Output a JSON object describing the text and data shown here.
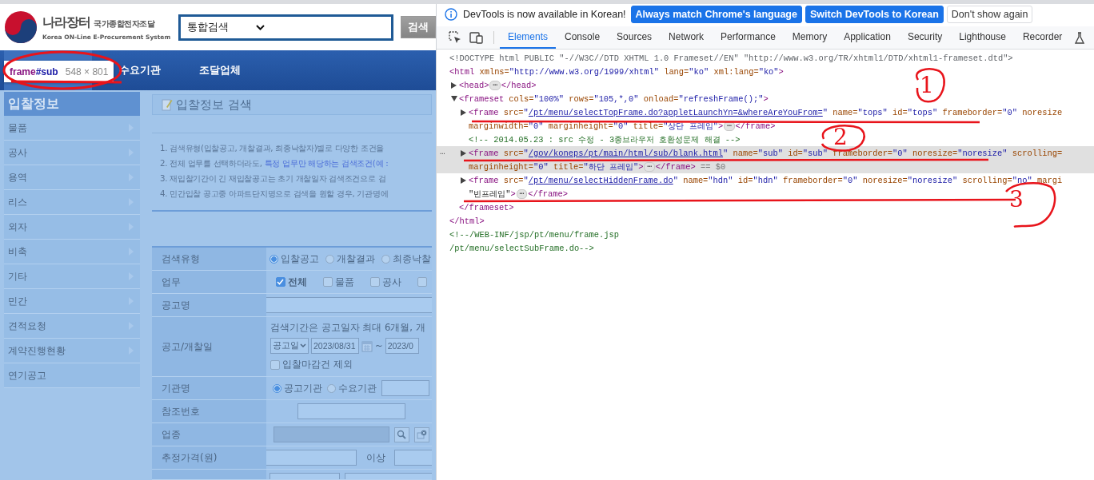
{
  "page": {
    "logo": {
      "title": "나라장터",
      "subtitle": "국가종합전자조달",
      "english": "Korea ON-Line E-Procurement System"
    },
    "search": {
      "scope": "통합검색",
      "button": "검색"
    },
    "nav": [
      {
        "selected": true
      },
      {
        "label": "수요기관",
        "selected": false
      },
      {
        "label": "조달업체",
        "selected": false
      }
    ],
    "frame_tooltip": {
      "tag": "frame",
      "id": "#sub",
      "size": "548 × 801"
    },
    "sidebar": {
      "title": "입찰정보",
      "items": [
        {
          "label": "물품",
          "expandable": true
        },
        {
          "label": "공사",
          "expandable": true
        },
        {
          "label": "용역",
          "expandable": true
        },
        {
          "label": "리스",
          "expandable": true
        },
        {
          "label": "외자",
          "expandable": true
        },
        {
          "label": "비축",
          "expandable": true
        },
        {
          "label": "기타",
          "expandable": true
        },
        {
          "label": "민간",
          "expandable": true
        },
        {
          "label": "견적요청",
          "expandable": true
        },
        {
          "label": "계약진행현황",
          "expandable": true
        },
        {
          "label": "연기공고",
          "expandable": false
        }
      ]
    },
    "panel_title": "입찰정보 검색",
    "notes": [
      {
        "text": "1. 검색유형(입찰공고, 개찰결과, 최종낙찰자)별로 다양한 조건을"
      },
      {
        "text": "2. 전체 업무를 선택하더라도, ",
        "highlight": "특정 업무만 해당하는 검색조건(예 :"
      },
      {
        "text": "3. 재입찰기간이 긴 재입찰공고는 초기 개찰일자 검색조건으로 검"
      },
      {
        "text": "4. 민간입찰 공고중 아파트단지명으로 검색을 원할 경우, 기관명에"
      }
    ],
    "form": [
      {
        "label": "검색유형",
        "kind": "radio",
        "options": [
          {
            "label": "입찰공고",
            "selected": true
          },
          {
            "label": "개찰결과",
            "selected": false
          },
          {
            "label": "최종낙찰",
            "selected": false
          }
        ]
      },
      {
        "label": "업무",
        "kind": "checks",
        "options": [
          {
            "label": "전체",
            "checked": true
          },
          {
            "label": "물품",
            "checked": false
          },
          {
            "label": "공사",
            "checked": false
          },
          {
            "checked": false
          }
        ]
      },
      {
        "label": "공고명",
        "kind": "input"
      },
      {
        "label": "공고/개찰일",
        "kind": "date",
        "note": "검색기간은 공고일자 최대 6개월, 개",
        "date_type": "공고일",
        "from": "2023/08/31",
        "separator": "~",
        "to": "2023/0",
        "exclude": {
          "label": "입찰마감건 제외",
          "checked": false
        }
      },
      {
        "label": "기관명",
        "kind": "agency",
        "options": [
          {
            "label": "공고기관",
            "selected": true
          },
          {
            "label": "수요기관",
            "selected": false
          }
        ]
      },
      {
        "label": "참조번호",
        "kind": "input"
      },
      {
        "label": "업종",
        "kind": "industry",
        "disabled": true
      },
      {
        "label": "추정가격(원)",
        "kind": "range",
        "unit": "이상"
      },
      {
        "kind": "partial"
      }
    ]
  },
  "devtools": {
    "infobar": {
      "message": "DevTools is now available in Korean!",
      "buttons": [
        {
          "label": "Always match Chrome's language",
          "kind": "primary"
        },
        {
          "label": "Switch DevTools to Korean",
          "kind": "primary"
        },
        {
          "label": "Don't show again",
          "kind": "plain"
        }
      ]
    },
    "tabs": [
      {
        "label": "Elements",
        "selected": true
      },
      {
        "label": "Console",
        "selected": false
      },
      {
        "label": "Sources",
        "selected": false
      },
      {
        "label": "Network",
        "selected": false
      },
      {
        "label": "Performance",
        "selected": false
      },
      {
        "label": "Memory",
        "selected": false
      },
      {
        "label": "Application",
        "selected": false
      },
      {
        "label": "Security",
        "selected": false
      },
      {
        "label": "Lighthouse",
        "selected": false
      },
      {
        "label": "Recorder",
        "selected": false
      }
    ],
    "dom": [
      {
        "selected": false,
        "lines": [
          [
            {
              "kind": "doctype",
              "text": "<!DOCTYPE html PUBLIC \"-//W3C//DTD XHTML 1.0 Frameset//EN\" \"http://www.w3.org/TR/xhtml1/DTD/xhtml1-frameset.dtd\">"
            }
          ]
        ]
      },
      {
        "selected": false,
        "lines": [
          [
            {
              "kind": "tag",
              "text": "<html"
            },
            {
              "kind": "attr",
              "text": " xmlns="
            },
            {
              "kind": "value",
              "text": "\"http://www.w3.org/1999/xhtml\""
            },
            {
              "kind": "attr",
              "text": " lang="
            },
            {
              "kind": "value",
              "text": "\"ko\""
            },
            {
              "kind": "attr",
              "text": " xml:lang="
            },
            {
              "kind": "value",
              "text": "\"ko\""
            },
            {
              "kind": "tag",
              "text": ">"
            }
          ]
        ],
        "close": [
          {
            "kind": "tag",
            "text": "</html>"
          }
        ],
        "children": [
          {
            "selected": false,
            "expanded": false,
            "lines": [
              [
                {
                  "kind": "tag",
                  "text": "<head>"
                },
                {
                  "kind": "badge",
                  "text": "⋯"
                },
                {
                  "kind": "tag",
                  "text": "</head>"
                }
              ]
            ]
          },
          {
            "selected": false,
            "expanded": true,
            "lines": [
              [
                {
                  "kind": "tag",
                  "text": "<frameset"
                },
                {
                  "kind": "attr",
                  "text": " cols="
                },
                {
                  "kind": "value",
                  "text": "\"100%\""
                },
                {
                  "kind": "attr",
                  "text": " rows="
                },
                {
                  "kind": "value",
                  "text": "\"105,*,0\""
                },
                {
                  "kind": "attr",
                  "text": " onload="
                },
                {
                  "kind": "value",
                  "text": "\"refreshFrame();\""
                },
                {
                  "kind": "tag",
                  "text": ">"
                }
              ]
            ],
            "close": [
              {
                "kind": "tag",
                "text": "</frameset>"
              }
            ],
            "children": [
              {
                "selected": false,
                "expanded": false,
                "lines": [
                  [
                    {
                      "kind": "tag",
                      "text": "<frame"
                    },
                    {
                      "kind": "attr",
                      "text": " src="
                    },
                    {
                      "kind": "value",
                      "text": "\""
                    },
                    {
                      "kind": "link",
                      "text": "/pt/menu/selectTopFrame.do?appletLaunchYn=&whereAreYouFrom="
                    },
                    {
                      "kind": "value",
                      "text": "\""
                    },
                    {
                      "kind": "attr",
                      "text": " name="
                    },
                    {
                      "kind": "value",
                      "text": "\"tops\""
                    },
                    {
                      "kind": "attr",
                      "text": " id="
                    },
                    {
                      "kind": "value",
                      "text": "\"tops\""
                    },
                    {
                      "kind": "attr",
                      "text": " frameborder="
                    },
                    {
                      "kind": "value",
                      "text": "\"0\""
                    },
                    {
                      "kind": "attr",
                      "text": " noresize"
                    }
                  ],
                  [
                    {
                      "kind": "attr",
                      "text": "marginwidth="
                    },
                    {
                      "kind": "value",
                      "text": "\"0\""
                    },
                    {
                      "kind": "attr",
                      "text": " marginheight="
                    },
                    {
                      "kind": "value",
                      "text": "\"0\""
                    },
                    {
                      "kind": "attr",
                      "text": " title="
                    },
                    {
                      "kind": "value",
                      "text": "\"상단 프레임\""
                    },
                    {
                      "kind": "tag",
                      "text": ">"
                    },
                    {
                      "kind": "badge",
                      "text": "⋯"
                    },
                    {
                      "kind": "tag",
                      "text": "</frame>"
                    }
                  ]
                ]
              },
              {
                "selected": false,
                "lines": [
                  [
                    {
                      "kind": "comment",
                      "text": "<!-- 2014.05.23 : src 수정 - 3종브라우저 호환성문제 해결 -->"
                    }
                  ]
                ]
              },
              {
                "selected": true,
                "gutter": "…",
                "expanded": false,
                "lines": [
                  [
                    {
                      "kind": "tag",
                      "text": "<frame"
                    },
                    {
                      "kind": "attr",
                      "text": " src="
                    },
                    {
                      "kind": "value",
                      "text": "\""
                    },
                    {
                      "kind": "link",
                      "text": "/gov/koneps/pt/main/html/sub/blank.html"
                    },
                    {
                      "kind": "value",
                      "text": "\""
                    },
                    {
                      "kind": "attr",
                      "text": " name="
                    },
                    {
                      "kind": "value",
                      "text": "\"sub\""
                    },
                    {
                      "kind": "attr",
                      "text": " id="
                    },
                    {
                      "kind": "value",
                      "text": "\"sub\""
                    },
                    {
                      "kind": "attr",
                      "text": " frameborder="
                    },
                    {
                      "kind": "value",
                      "text": "\"0\""
                    },
                    {
                      "kind": "attr",
                      "text": " noresize="
                    },
                    {
                      "kind": "value",
                      "text": "\"noresize\""
                    },
                    {
                      "kind": "attr",
                      "text": " scrolling="
                    }
                  ],
                  [
                    {
                      "kind": "attr",
                      "text": "marginheight="
                    },
                    {
                      "kind": "value",
                      "text": "\"0\""
                    },
                    {
                      "kind": "attr",
                      "text": " title="
                    },
                    {
                      "kind": "value",
                      "text": "\"하단 프레임\""
                    },
                    {
                      "kind": "tag",
                      "text": ">"
                    },
                    {
                      "kind": "badge",
                      "text": "⋯"
                    },
                    {
                      "kind": "tag",
                      "text": "</frame>"
                    },
                    {
                      "kind": "dollar",
                      "text": " == $0"
                    }
                  ]
                ]
              },
              {
                "selected": false,
                "expanded": false,
                "lines": [
                  [
                    {
                      "kind": "tag",
                      "text": "<frame"
                    },
                    {
                      "kind": "attr",
                      "text": " src="
                    },
                    {
                      "kind": "value",
                      "text": "\""
                    },
                    {
                      "kind": "link",
                      "text": "/pt/menu/selectHiddenFrame.do"
                    },
                    {
                      "kind": "value",
                      "text": "\""
                    },
                    {
                      "kind": "attr",
                      "text": " name="
                    },
                    {
                      "kind": "value",
                      "text": "\"hdn\""
                    },
                    {
                      "kind": "attr",
                      "text": " id="
                    },
                    {
                      "kind": "value",
                      "text": "\"hdn\""
                    },
                    {
                      "kind": "attr",
                      "text": " frameborder="
                    },
                    {
                      "kind": "value",
                      "text": "\"0\""
                    },
                    {
                      "kind": "attr",
                      "text": " noresize="
                    },
                    {
                      "kind": "value",
                      "text": "\"noresize\""
                    },
                    {
                      "kind": "attr",
                      "text": " scrolling="
                    },
                    {
                      "kind": "value",
                      "text": "\"no\""
                    },
                    {
                      "kind": "attr",
                      "text": " margi"
                    }
                  ],
                  [
                    {
                      "kind": "text",
                      "text": "\"빈프레임\""
                    },
                    {
                      "kind": "tag",
                      "text": ">"
                    },
                    {
                      "kind": "badge",
                      "text": "⋯"
                    },
                    {
                      "kind": "tag",
                      "text": "</frame>"
                    }
                  ]
                ]
              }
            ]
          }
        ]
      },
      {
        "selected": false,
        "lines": [
          [
            {
              "kind": "comment",
              "text": "<!--/WEB-INF/jsp/pt/menu/frame.jsp"
            }
          ],
          [
            {
              "kind": "comment",
              "text": "/pt/menu/selectSubFrame.do-->"
            }
          ]
        ]
      }
    ]
  },
  "annotations": [
    {
      "text": "1"
    },
    {
      "text": "2"
    },
    {
      "text": "3"
    }
  ]
}
